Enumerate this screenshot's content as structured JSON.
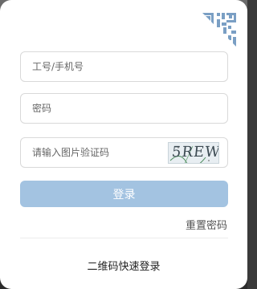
{
  "form": {
    "username_placeholder": "工号/手机号",
    "password_placeholder": "密码",
    "captcha_placeholder": "请输入图片验证码",
    "captcha_text": "5REW",
    "login_label": "登录",
    "reset_label": "重置密码",
    "qr_login_label": "二维码快速登录"
  },
  "icons": {
    "corner": "qr-code-icon"
  },
  "colors": {
    "button": "#a3c3e1",
    "qr_icon": "#7a9fc4"
  }
}
